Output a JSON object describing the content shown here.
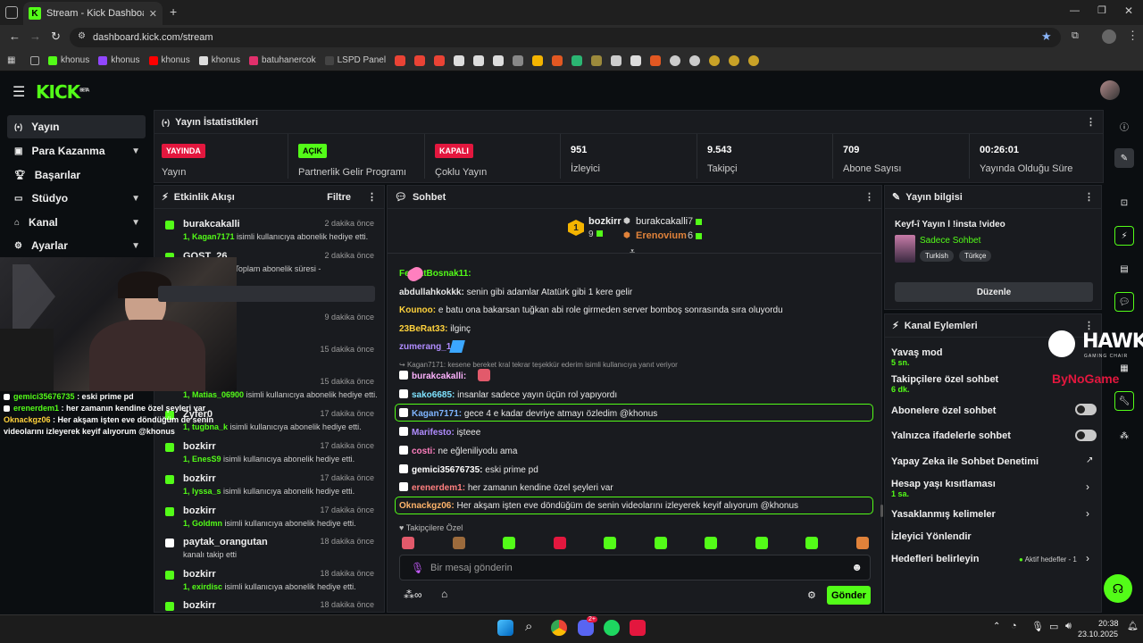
{
  "browser": {
    "tab_title": "Stream - Kick Dashboard",
    "url": "dashboard.kick.com/stream",
    "bookmarks": [
      "khonus",
      "khonus",
      "khonus",
      "khonus",
      "batuhanercok",
      "LSPD Panel"
    ]
  },
  "sidebar": {
    "items": [
      {
        "label": "Yayın"
      },
      {
        "label": "Para Kazanma"
      },
      {
        "label": "Başarılar"
      },
      {
        "label": "Stüdyo"
      },
      {
        "label": "Kanal"
      },
      {
        "label": "Ayarlar"
      }
    ]
  },
  "stats": {
    "title": "Yayın İstatistikleri",
    "items": [
      {
        "badge": "YAYINDA",
        "label": "Yayın"
      },
      {
        "badge": "AÇIK",
        "label": "Partnerlik Gelir Programı"
      },
      {
        "badge": "KAPALI",
        "label": "Çoklu Yayın"
      },
      {
        "value": "951",
        "label": "İzleyici"
      },
      {
        "value": "9.543",
        "label": "Takipçi"
      },
      {
        "value": "709",
        "label": "Abone Sayısı"
      },
      {
        "value": "00:26:01",
        "label": "Yayında Olduğu Süre"
      }
    ]
  },
  "activity": {
    "title": "Etkinlik Akışı",
    "filter": "Filtre",
    "items": [
      {
        "name": "burakcakalli",
        "time": "2 dakika önce",
        "user": "1, Kagan7171",
        "text": " isimli kullanıcıya abonelik hediye etti."
      },
      {
        "name": "GOST_26",
        "time": "2 dakika önce",
        "user": "",
        "text": "esini kutluyor! Toplam abonelik süresi -"
      },
      {
        "name": "",
        "time": "9 dakika önce",
        "user": "",
        "text": ""
      },
      {
        "name": "",
        "time": "15 dakika önce",
        "user": "",
        "text": ""
      },
      {
        "name": "",
        "time": "15 dakika önce",
        "user": "1, Matias_06900",
        "text": " isimli kullanıcıya abonelik hediye etti."
      },
      {
        "name": "Zyfer0",
        "time": "17 dakika önce",
        "user": "1, tugbna_k",
        "text": " isimli kullanıcıya abonelik hediye etti."
      },
      {
        "name": "bozkirr",
        "time": "17 dakika önce",
        "user": "1, EnesS9",
        "text": " isimli kullanıcıya abonelik hediye etti."
      },
      {
        "name": "bozkirr",
        "time": "17 dakika önce",
        "user": "1, lyssa_s",
        "text": " isimli kullanıcıya abonelik hediye etti."
      },
      {
        "name": "bozkirr",
        "time": "17 dakika önce",
        "user": "1, Goldmn",
        "text": " isimli kullanıcıya abonelik hediye etti."
      },
      {
        "name": "paytak_orangutan",
        "time": "18 dakika önce",
        "user": "",
        "text": "kanalı takip etti"
      },
      {
        "name": "bozkirr",
        "time": "18 dakika önce",
        "user": "1, exirdisc",
        "text": " isimli kullanıcıya abonelik hediye etti."
      },
      {
        "name": "bozkirr",
        "time": "18 dakika önce",
        "user": "",
        "text": ""
      }
    ]
  },
  "chat": {
    "title": "Sohbet",
    "top_gifter": {
      "rank": "1",
      "name": "bozkirr",
      "count": "9"
    },
    "gifters": [
      {
        "name": "burakcakalli",
        "count": "7"
      },
      {
        "name": "Erenovium",
        "count": "6"
      }
    ],
    "messages": [
      {
        "user": "FerhatBosnak11:",
        "text": "",
        "color": "#53fc18"
      },
      {
        "user": "abdullahkokkk:",
        "text": "senin gibi adamlar Atatürk gibi 1 kere gelir",
        "color": "#e8e8e8"
      },
      {
        "user": "Kounoo:",
        "text": "e batu ona bakarsan tuğkan abi role girmeden server bomboş sonrasında sıra oluyordu",
        "color": "#ffd23c"
      },
      {
        "user": "23BeRat33:",
        "text": "ilginç",
        "color": "#ffd23c"
      },
      {
        "user": "zumerang_1:",
        "text": "",
        "color": "#b08cff"
      },
      {
        "user": "burakcakalli:",
        "text": "",
        "color": "#ffb3ff"
      },
      {
        "user": "sako6685:",
        "text": "insanlar sadece yayın üçün rol yapıyordı",
        "color": "#7fe3ff"
      },
      {
        "user": "Kagan7171:",
        "text": "gece 4 e kadar devriye atmayı özledim @khonus",
        "color": "#7fb4ff"
      },
      {
        "user": "Marifesto:",
        "text": "işteee",
        "color": "#b08cff"
      },
      {
        "user": "costi:",
        "text": "ne eğleniliyodu ama",
        "color": "#ff7fbf"
      },
      {
        "user": "gemici35676735:",
        "text": "eski prime pd",
        "color": "#ffffff"
      },
      {
        "user": "erenerdem1:",
        "text": "her zamanın kendine özel şeyleri var",
        "color": "#ff7f7f"
      },
      {
        "user": "Oknackgz06:",
        "text": "Her akşam işten eve döndüğüm de senin videolarını izleyerek keyif alıyorum @khonus",
        "color": "#ffb46b"
      }
    ],
    "reply_to": "Kagan7171: kesene bereket kral tekrar teşekkür ederim isimli kullanıcıya yanıt veriyor",
    "followers_only": "Takipçilere Özel",
    "input_placeholder": "Bir mesaj gönderin",
    "send": "Gönder"
  },
  "stream_info": {
    "title": "Yayın bilgisi",
    "stream_title": "Keyf-î Yayın l !insta !video",
    "category": "Sadece Sohbet",
    "tags": [
      "Turkish",
      "Türkçe"
    ],
    "edit": "Düzenle"
  },
  "channel_actions": {
    "title": "Kanal Eylemleri",
    "slow_mode": {
      "label": "Yavaş mod",
      "value": "5 sn."
    },
    "followers_chat": {
      "label": "Takipçilere özel sohbet",
      "value": "6 dk."
    },
    "subscribers_chat": "Abonelere özel sohbet",
    "emotes_only": "Yalnızca ifadelerle sohbet",
    "ai_moderation": "Yapay Zeka ile Sohbet Denetimi",
    "age_restriction": {
      "label": "Hesap yaşı kısıtlaması",
      "value": "1 sa."
    },
    "banned_words": "Yasaklanmış kelimeler",
    "viewer_redirect": "İzleyici Yönlendir",
    "goals": {
      "label": "Hedefleri belirleyin",
      "value": "Aktif hedefler - 1"
    }
  },
  "overlay": {
    "lines": [
      {
        "user": "gemici35676735",
        "text": " : eski prime pd",
        "color": "#53fc18"
      },
      {
        "user": "erenerdem1",
        "text": " : her zamanın kendine özel şeyleri var",
        "color": "#53fc18"
      },
      {
        "user": "Oknackgz06",
        "text": " : Her akşam işten eve döndüğüm de senin videolarını izleyerek keyif alıyorum @khonus",
        "color": "#53fc18"
      }
    ],
    "sponsor": "HAWK",
    "sponsor_sub": "GAMING CHAIR",
    "sponsor2": "ByNoGame"
  },
  "taskbar": {
    "time": "20:38",
    "date": "23.10.2025",
    "discord_badge": "2+"
  },
  "colors": {
    "accent": "#53fc18",
    "live": "#e3173e",
    "bg": "#0b0e11",
    "panel": "#191b1f"
  }
}
